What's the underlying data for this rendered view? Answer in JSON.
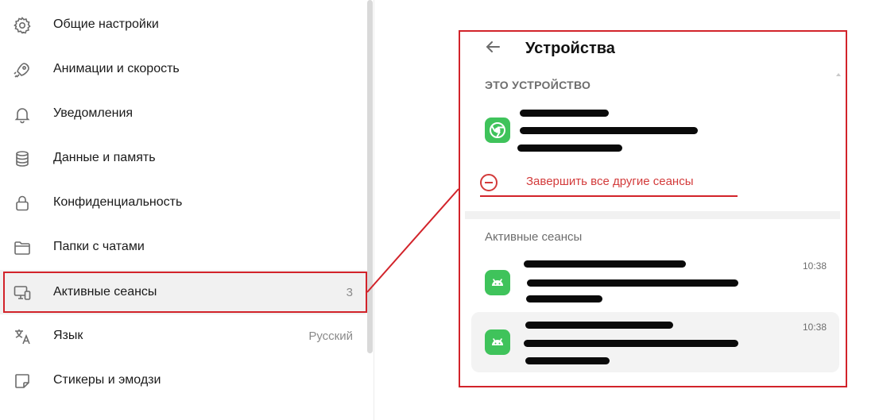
{
  "settings": {
    "items": [
      {
        "label": "Общие настройки",
        "icon": "gear-icon",
        "value": ""
      },
      {
        "label": "Анимации и скорость",
        "icon": "rocket-icon",
        "value": ""
      },
      {
        "label": "Уведомления",
        "icon": "bell-icon",
        "value": ""
      },
      {
        "label": "Данные и память",
        "icon": "database-icon",
        "value": ""
      },
      {
        "label": "Конфиденциальность",
        "icon": "lock-icon",
        "value": ""
      },
      {
        "label": "Папки с чатами",
        "icon": "folder-icon",
        "value": ""
      },
      {
        "label": "Активные сеансы",
        "icon": "devices-icon",
        "value": "3"
      },
      {
        "label": "Язык",
        "icon": "translate-icon",
        "value": "Русский"
      },
      {
        "label": "Стикеры и эмодзи",
        "icon": "sticker-icon",
        "value": ""
      }
    ]
  },
  "devices": {
    "title": "Устройства",
    "this_device_header": "ЭТО УСТРОЙСТВО",
    "terminate_label": "Завершить все другие сеансы",
    "active_sessions_header": "Активные сеансы",
    "sessions": [
      {
        "time": "10:38",
        "icon": "android-icon"
      },
      {
        "time": "10:38",
        "icon": "android-icon"
      }
    ],
    "current_device_icon": "chrome-icon"
  },
  "colors": {
    "highlight_border": "#d2232a",
    "app_icon_green": "#3fc35b",
    "danger_text": "#d33a3a"
  }
}
